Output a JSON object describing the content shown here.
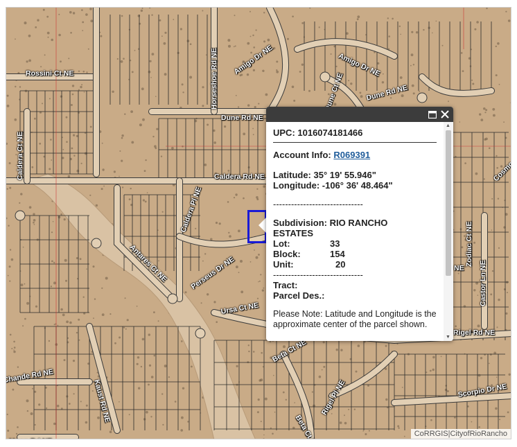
{
  "map": {
    "attribution": "CoRRGIS|CityofRioRancho",
    "streets": [
      {
        "name": "Rossini Ct NE"
      },
      {
        "name": "Horseshoe Rd NE"
      },
      {
        "name": "Amigo Dr NE"
      },
      {
        "name": "Amigo Dr NE"
      },
      {
        "name": "Dune Ct NE"
      },
      {
        "name": "Dune Rd NE"
      },
      {
        "name": "Dune Rd NE"
      },
      {
        "name": "Caldera Ct NE"
      },
      {
        "name": "Caldera Rd NE"
      },
      {
        "name": "Caldera Pl NE"
      },
      {
        "name": "Antares Ct NE"
      },
      {
        "name": "Perseus Dr NE"
      },
      {
        "name": "Ursa Ct NE"
      },
      {
        "name": "Cosmo Ct"
      },
      {
        "name": "Zodiac Ct NE"
      },
      {
        "name": "Castor Ln NE"
      },
      {
        "name": "Rigel Rd NE"
      },
      {
        "name": "Rigel Pl NE"
      },
      {
        "name": "Kaust Rd NE"
      },
      {
        "name": "Chande Rd NE"
      },
      {
        "name": "Beta Ct NE"
      },
      {
        "name": "Beta Ct NE"
      },
      {
        "name": "Scorpio Dr NE"
      },
      {
        "name": "Moon Rd NE"
      },
      {
        "name": "NE"
      }
    ]
  },
  "popup": {
    "upc": "UPC: 1016074181466",
    "account_label": "Account Info:",
    "account_link": "R069391",
    "latitude": "Latitude: 35° 19' 55.946\"",
    "longitude": "Longitude: -106° 36' 48.464\"",
    "dashes": "------------------------------",
    "subdivision_line1": "Subdivision: RIO RANCHO",
    "subdivision_line2": "ESTATES",
    "lot_label": "Lot:",
    "lot_value": "33",
    "block_label": "Block:",
    "block_value": "154",
    "unit_label": "Unit:",
    "unit_value": "20",
    "dashes2": "------------------------------",
    "tract_label": "Tract:",
    "parcel_label": "Parcel Des.:",
    "note": "Please Note: Latitude and Longitude is the approximate center of the parcel shown.",
    "maximize_icon": "maximize-icon",
    "close_icon": "close-icon"
  },
  "colors": {
    "terrain": "#c9ab87",
    "riverbed": "#d9c2a4",
    "lot_lines": "#2b2b2b",
    "road": "#e2cfb4",
    "selected_parcel": "#1a1ad6",
    "popup_header": "#3c3c3c"
  }
}
